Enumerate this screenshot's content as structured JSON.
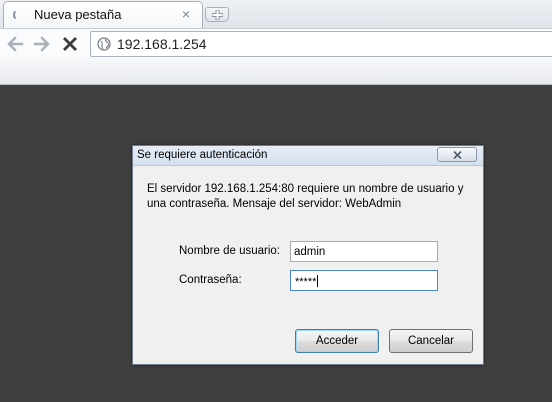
{
  "browser": {
    "tab": {
      "title": "Nueva pestaña",
      "close_glyph": "×"
    },
    "omnibox": {
      "url": "192.168.1.254"
    }
  },
  "dialog": {
    "title": "Se requiere autenticación",
    "message": "El servidor 192.168.1.254:80 requiere un nombre de usuario y una contraseña. Mensaje del servidor: WebAdmin",
    "username_label": "Nombre de usuario:",
    "username_value": "admin",
    "password_label": "Contraseña:",
    "password_mask": "*****",
    "ok_label": "Acceder",
    "cancel_label": "Cancelar"
  },
  "icons": {
    "tab_loading": "loading-spinner-icon",
    "new_tab": "plus-icon",
    "back": "arrow-left-icon",
    "forward": "arrow-right-icon",
    "stop": "close-x-icon",
    "site": "globe-icon",
    "dialog_close": "close-x-icon"
  },
  "colors": {
    "page_background": "#3f3f3f",
    "focus_border": "#4a86c8",
    "default_button_border": "#3c7fb1"
  }
}
